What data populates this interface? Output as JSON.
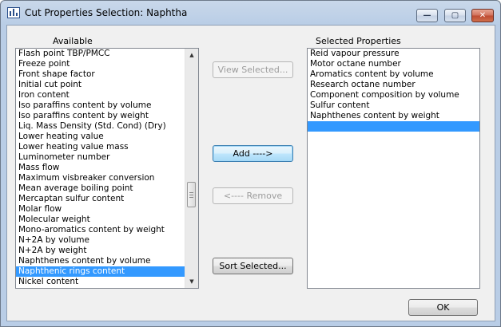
{
  "window": {
    "title": "Cut Properties Selection: Naphtha",
    "minimize_glyph": "—",
    "maximize_glyph": "▢",
    "close_glyph": "✕"
  },
  "available": {
    "caption": "Available",
    "items": [
      "Flash point TBP/PMCC",
      "Freeze point",
      "Front shape factor",
      "Initial cut point",
      "Iron content",
      "Iso paraffins content by volume",
      "Iso paraffins content by weight",
      "Liq. Mass Density (Std. Cond) (Dry)",
      "Lower heating value",
      "Lower heating value mass",
      "Luminometer number",
      "Mass flow",
      "Maximum visbreaker conversion",
      "Mean average boiling point",
      "Mercaptan sulfur content",
      "Molar flow",
      "Molecular weight",
      "Mono-aromatics content by weight",
      "N+2A by volume",
      "N+2A by weight",
      "Naphthenes content by volume",
      "Naphthenic rings content",
      "Nickel content"
    ],
    "selected_index": 21
  },
  "selected": {
    "caption": "Selected Properties",
    "items": [
      "Reid vapour pressure",
      "Motor octane number",
      "Aromatics content by volume",
      "Research octane number",
      "Component composition by volume",
      "Sulfur content",
      "Naphthenes content by weight",
      ""
    ],
    "selected_index": 7
  },
  "buttons": {
    "view_selected": "View Selected...",
    "add": "Add ---->",
    "remove": "<---- Remove",
    "sort_selected": "Sort Selected...",
    "ok": "OK"
  },
  "icons": {
    "app": "chart-app-icon",
    "scroll_up": "▲",
    "scroll_down": "▼"
  }
}
